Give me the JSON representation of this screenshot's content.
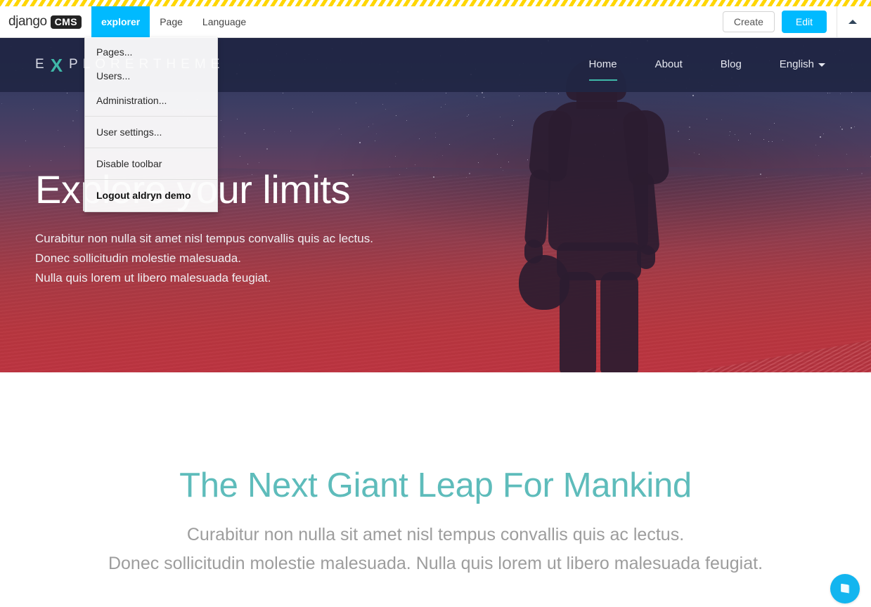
{
  "toolbar": {
    "brand_name": "django",
    "brand_badge": "CMS",
    "menu_items": [
      {
        "label": "explorer",
        "active": true
      },
      {
        "label": "Page",
        "active": false
      },
      {
        "label": "Language",
        "active": false
      }
    ],
    "create_label": "Create",
    "edit_label": "Edit",
    "collapse_icon": "chevron-up-icon",
    "accent_color": "#00baff",
    "hazard_color": "#ffd600"
  },
  "dropdown": {
    "open_for": "explorer",
    "items": [
      {
        "label": "Pages...",
        "bold": false,
        "separator_after": false
      },
      {
        "label": "Users...",
        "bold": false,
        "separator_after": false
      },
      {
        "label": "Administration...",
        "bold": false,
        "separator_after": true
      },
      {
        "label": "User settings...",
        "bold": false,
        "separator_after": true
      },
      {
        "label": "Disable toolbar",
        "bold": false,
        "separator_after": true
      },
      {
        "label": "Logout aldryn demo",
        "bold": true,
        "separator_after": false
      }
    ]
  },
  "site": {
    "logo_text": "EXPLORERTHEME",
    "logo_pre": "E",
    "logo_x": "X",
    "logo_post": "PLORERTHEME",
    "nav": [
      {
        "label": "Home",
        "active": true,
        "has_caret": false
      },
      {
        "label": "About",
        "active": false,
        "has_caret": false
      },
      {
        "label": "Blog",
        "active": false,
        "has_caret": false
      },
      {
        "label": "English",
        "active": false,
        "has_caret": true
      }
    ],
    "nav_accent": "#3fb8a8"
  },
  "hero": {
    "title": "Explore your limits",
    "lines": [
      "Curabitur non nulla sit amet nisl tempus convallis quis ac lectus.",
      "Donec sollicitudin molestie malesuada.",
      "Nulla quis lorem ut libero malesuada feugiat."
    ]
  },
  "main": {
    "title": "The Next Giant Leap For Mankind",
    "lines": [
      "Curabitur non nulla sit amet nisl tempus convallis quis ac lectus.",
      "Donec sollicitudin molestie malesuada. Nulla quis lorem ut libero malesuada feugiat."
    ],
    "title_color": "#5ebcbb"
  },
  "fab": {
    "icon": "book-icon",
    "color": "#13b5ef"
  }
}
